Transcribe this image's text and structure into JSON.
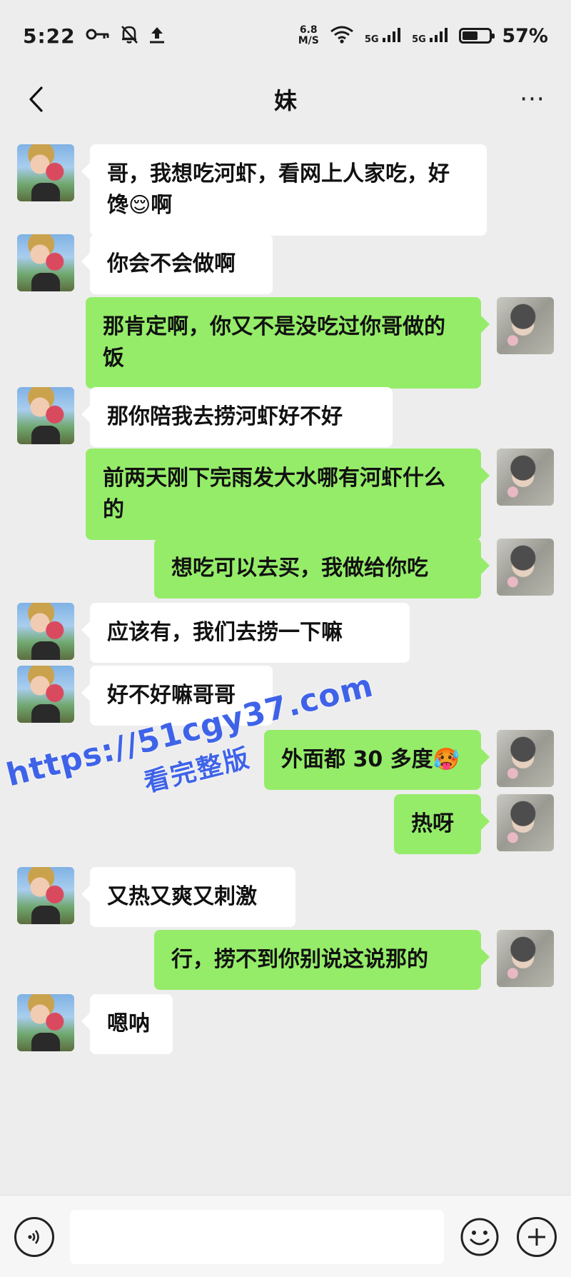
{
  "status_bar": {
    "time": "5:22",
    "icons": [
      "key-icon",
      "bell-muted-icon",
      "upload-icon"
    ],
    "network_speed_value": "6.8",
    "network_speed_unit": "M/S",
    "signal1_label": "5G",
    "signal2_label": "5G",
    "battery_percent": "57%",
    "battery_level": 0.57
  },
  "nav": {
    "title": "妹",
    "more_label": "···"
  },
  "colors": {
    "background": "#ededed",
    "sent_bubble": "#95ec69",
    "received_bubble": "#ffffff",
    "watermark": "#3f63e8"
  },
  "messages": [
    {
      "side": "left",
      "text": "哥，我想吃河虾，看网上人家吃，好馋😌啊"
    },
    {
      "side": "left",
      "text": "你会不会做啊"
    },
    {
      "side": "right",
      "text": "那肯定啊，你又不是没吃过你哥做的饭"
    },
    {
      "side": "left",
      "text": "那你陪我去捞河虾好不好"
    },
    {
      "side": "right",
      "text": "前两天刚下完雨发大水哪有河虾什么的"
    },
    {
      "side": "right",
      "text": "想吃可以去买，我做给你吃"
    },
    {
      "side": "left",
      "text": "应该有，我们去捞一下嘛"
    },
    {
      "side": "left",
      "text": "好不好嘛哥哥"
    },
    {
      "side": "right",
      "text": "外面都 30 多度🥵"
    },
    {
      "side": "right",
      "text": "热呀"
    },
    {
      "side": "left",
      "text": "又热又爽又刺激"
    },
    {
      "side": "right",
      "text": "行，捞不到你别说这说那的"
    },
    {
      "side": "left",
      "text": "嗯呐"
    }
  ],
  "watermark": {
    "line1": "https://51cgy37.com",
    "line2": "看完整版"
  },
  "input_bar": {
    "input_value": "",
    "input_placeholder": ""
  }
}
